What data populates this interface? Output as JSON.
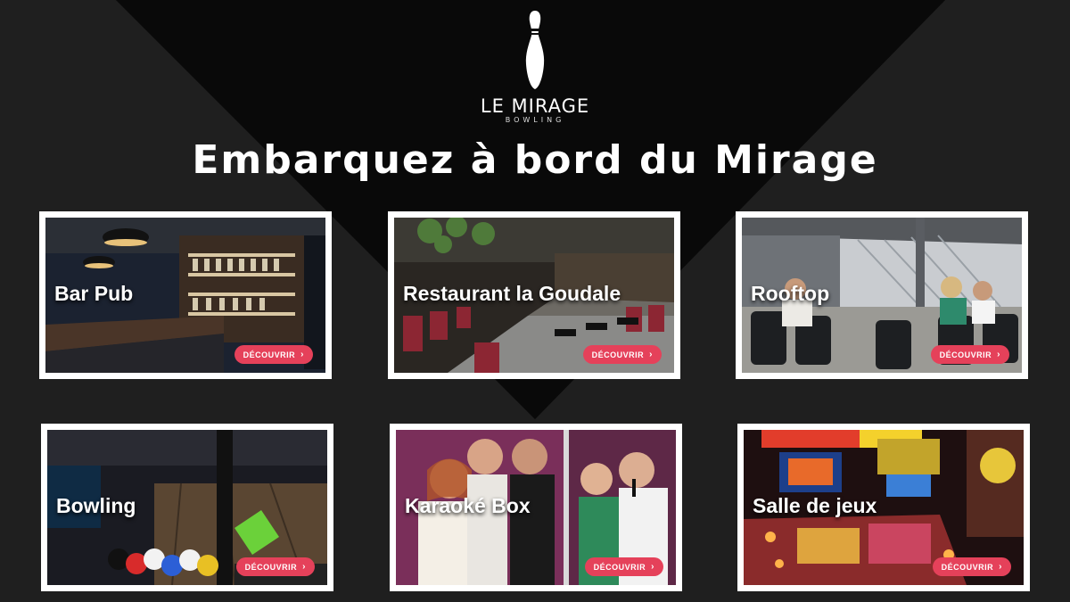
{
  "brand": {
    "name_part1": "LE ",
    "name_part2": "MIRAGE",
    "subtitle": "BOWLING",
    "logo_icon": "bowling-pin-icon"
  },
  "headline": "Embarquez à bord du Mirage",
  "button_label": "DÉCOUVRIR",
  "button_icon": "chevron-right-icon",
  "accent_color": "#e5415a",
  "cards": [
    {
      "title": "Bar Pub"
    },
    {
      "title": "Restaurant la Goudale"
    },
    {
      "title": "Rooftop"
    },
    {
      "title": "Bowling"
    },
    {
      "title": "Karaoké Box"
    },
    {
      "title": "Salle de jeux"
    }
  ]
}
